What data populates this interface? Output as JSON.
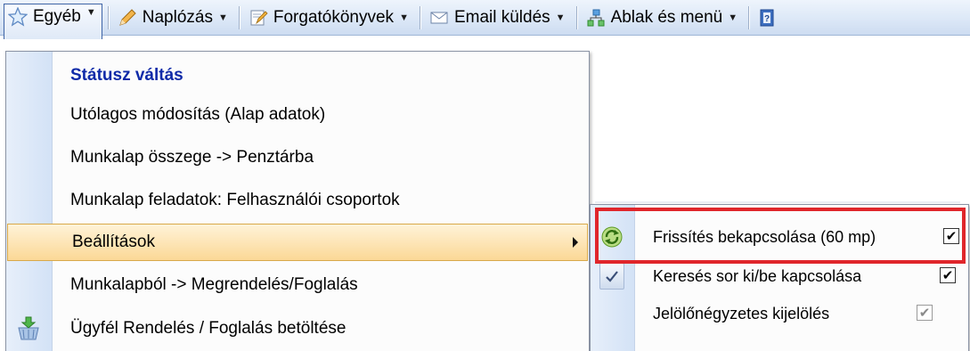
{
  "toolbar": {
    "items": [
      {
        "label": "Egyéb",
        "icon": "star-icon"
      },
      {
        "label": "Naplózás",
        "icon": "pencil-icon"
      },
      {
        "label": "Forgatókönyvek",
        "icon": "script-edit-icon"
      },
      {
        "label": "Email küldés",
        "icon": "envelope-icon"
      },
      {
        "label": "Ablak és menü",
        "icon": "window-tree-icon"
      },
      {
        "label": "",
        "icon": "help-icon"
      }
    ]
  },
  "menu": {
    "items": [
      {
        "label": "Státusz váltás"
      },
      {
        "label": "Utólagos módosítás (Alap adatok)"
      },
      {
        "label": "Munkalap összege -> Penztárba"
      },
      {
        "label": "Munkalap feladatok: Felhasználói csoportok"
      },
      {
        "label": "Beállítások"
      },
      {
        "label": "Munkalapból -> Megrendelés/Foglalás"
      },
      {
        "label": "Ügyfél Rendelés / Foglalás betöltése"
      }
    ]
  },
  "submenu": {
    "items": [
      {
        "label": "Frissítés bekapcsolása (60 mp)",
        "checked": true
      },
      {
        "label": "Keresés sor ki/be kapcsolása",
        "checked": true
      },
      {
        "label": "Jelölőnégyzetes kijelölés",
        "checked": true,
        "disabled": true
      }
    ]
  },
  "colors": {
    "highlight": "#e0262b",
    "bold_label": "#0f2aa8",
    "active_row": "#fbd896"
  }
}
